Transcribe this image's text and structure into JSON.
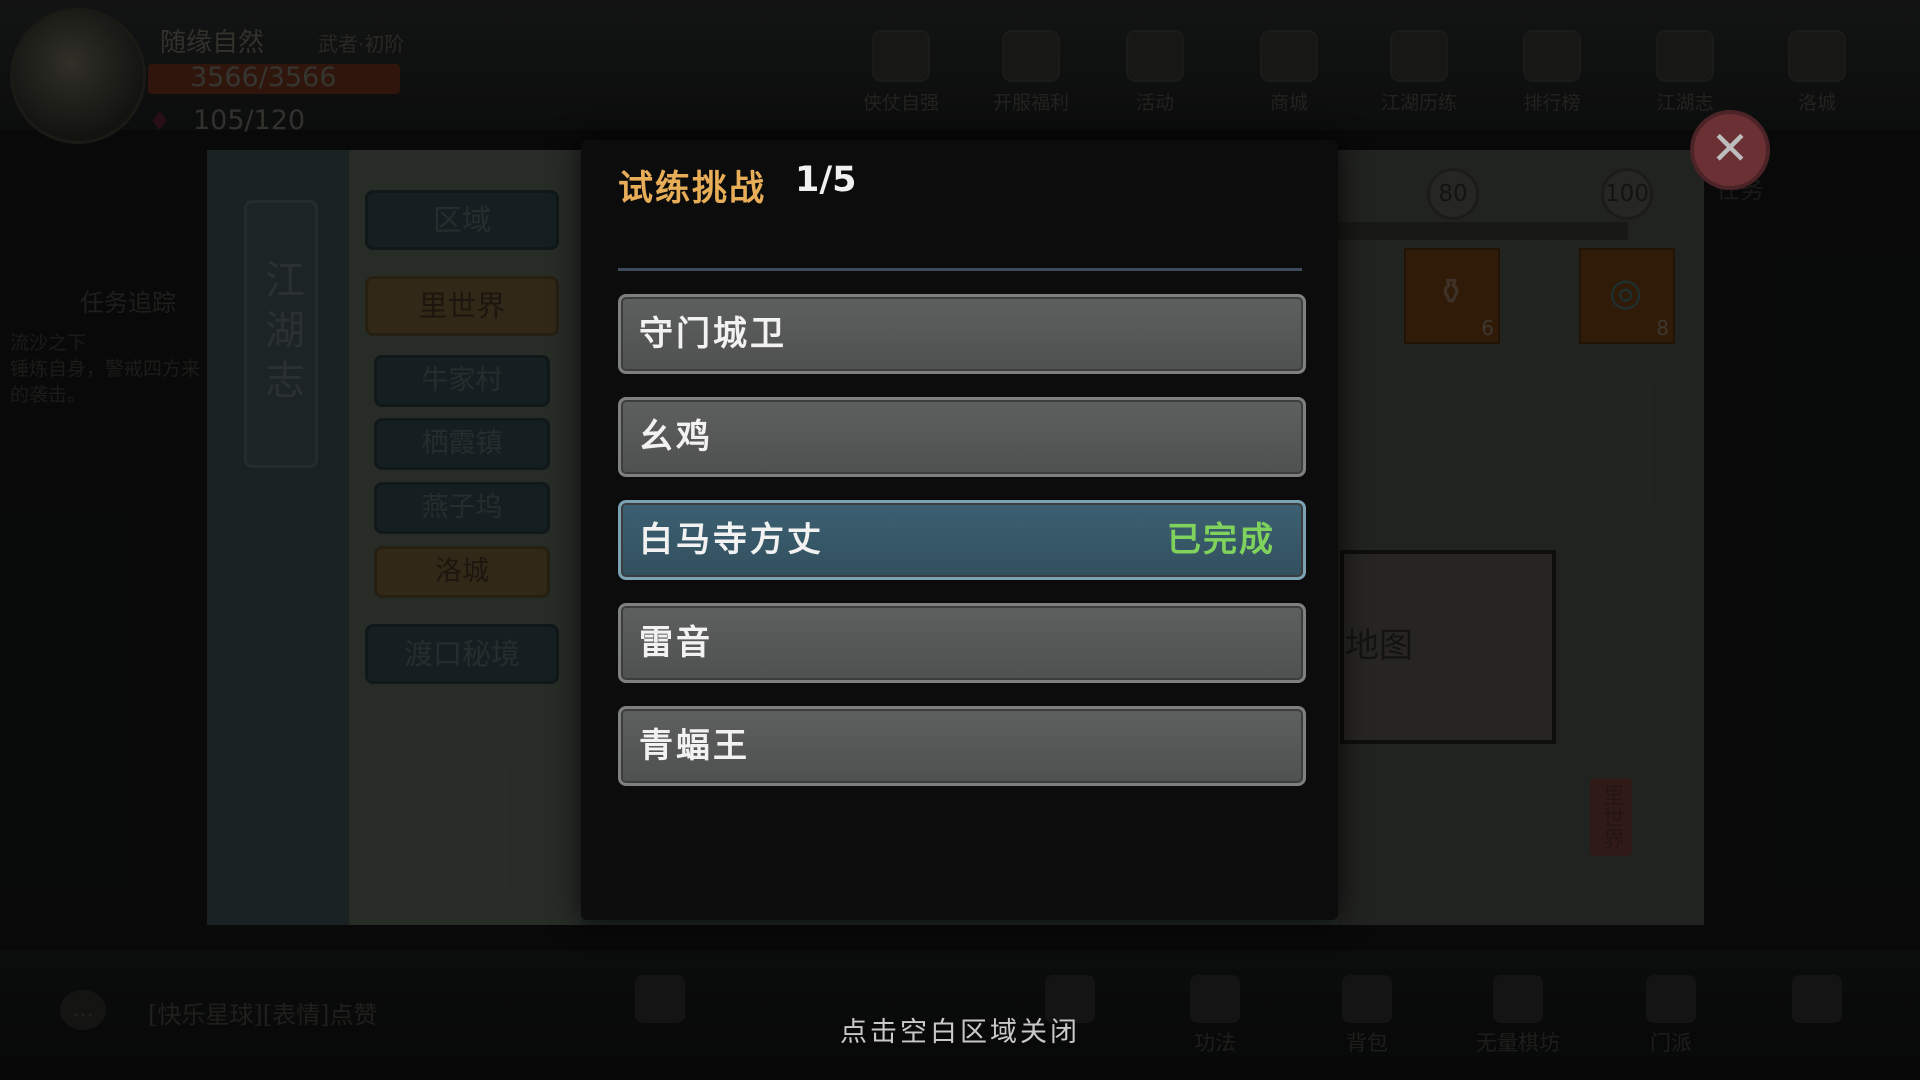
{
  "hud": {
    "player_name": "随缘自然",
    "player_rank": "武者·初阶",
    "hp": "3566/3566",
    "hp_ratio": 1.0,
    "stamina": "105/120",
    "top_menu": [
      "侠仗自强",
      "开服福利",
      "活动",
      "商城",
      "江湖历练",
      "排行榜",
      "江湖志",
      "洛城"
    ],
    "quest_title": "任务追踪",
    "quest_text": "流沙之下\n锤炼自身，警戒四方来的袭击。",
    "chat_text": "[快乐星球][表情]点赞",
    "bottom_menu": [
      "",
      "",
      "",
      "功法",
      "背包",
      "无量棋坊",
      "门派"
    ]
  },
  "journal": {
    "title": "江湖志",
    "nav": [
      {
        "label": "区域",
        "style": "big"
      },
      {
        "label": "里世界",
        "style": "gold-big"
      },
      {
        "label": "牛家村",
        "style": "small"
      },
      {
        "label": "栖霞镇",
        "style": "small"
      },
      {
        "label": "燕子坞",
        "style": "small"
      },
      {
        "label": "洛城",
        "style": "gold-small"
      },
      {
        "label": "渡口秘境",
        "style": "big"
      }
    ],
    "score_marks": [
      "80",
      "100"
    ],
    "reward_counts": [
      "6",
      "8"
    ],
    "map_label": "地图",
    "seal_text": "里世界",
    "right_tag": "任务"
  },
  "modal": {
    "title": "试练挑战",
    "count": "1/5",
    "challenges": [
      {
        "name": "守门城卫",
        "status": ""
      },
      {
        "name": "幺鸡",
        "status": ""
      },
      {
        "name": "白马寺方丈",
        "status": "已完成"
      },
      {
        "name": "雷音",
        "status": ""
      },
      {
        "name": "青蝠王",
        "status": ""
      }
    ],
    "close_hint": "点击空白区域关闭"
  },
  "colors": {
    "title_gold": "#e7ad57",
    "completed_green": "#7fd25c",
    "completed_row": "#3c6072"
  }
}
